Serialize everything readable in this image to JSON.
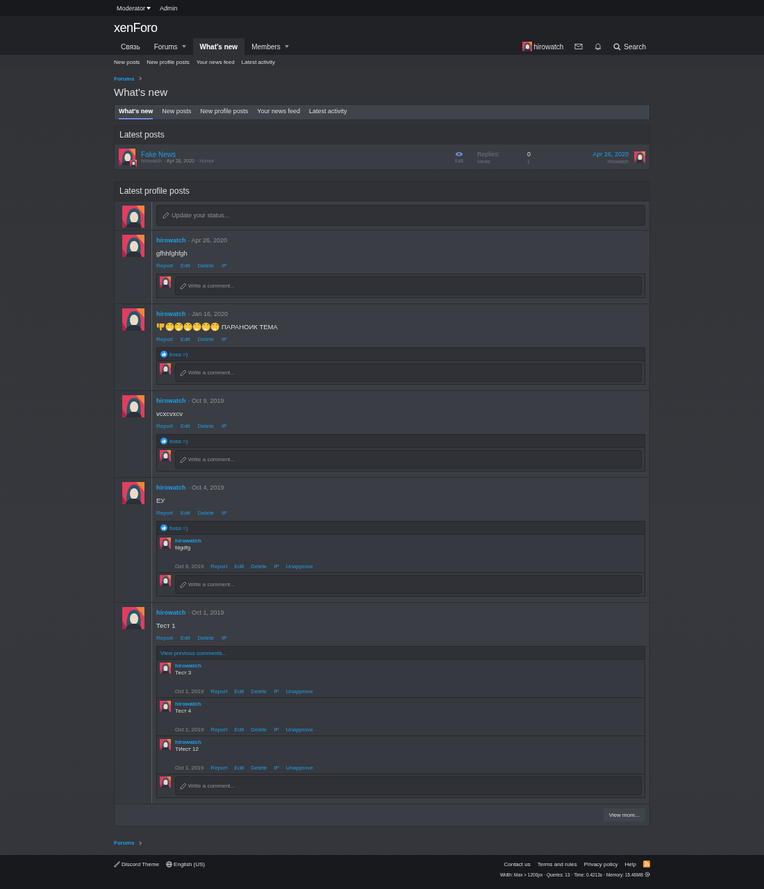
{
  "staff_bar": [
    {
      "label": "Moderator",
      "dropdown": true
    },
    {
      "label": "Admin",
      "dropdown": false
    }
  ],
  "logo": "xenForo",
  "nav": [
    {
      "label": "Связь",
      "dropdown": false,
      "selected": false
    },
    {
      "label": "Forums",
      "dropdown": true,
      "selected": false
    },
    {
      "label": "What's new",
      "dropdown": false,
      "selected": true
    },
    {
      "label": "Members",
      "dropdown": true,
      "selected": false
    }
  ],
  "user": {
    "name": "hirowatch",
    "search": "Search"
  },
  "sub_nav": [
    "New posts",
    "New profile posts",
    "Your news feed",
    "Latest activity"
  ],
  "breadcrumb": "Forums",
  "title": "What's new",
  "tabs": [
    {
      "label": "What's new",
      "selected": true
    },
    {
      "label": "New posts",
      "selected": false
    },
    {
      "label": "New profile posts",
      "selected": false
    },
    {
      "label": "Your news feed",
      "selected": false
    },
    {
      "label": "Latest activity",
      "selected": false
    }
  ],
  "latest_posts": {
    "heading": "Latest posts",
    "threads": [
      {
        "title": "Fake News",
        "author": "hirowatch",
        "date": "· Apr 26, 2020",
        "forum": "· Humor",
        "edit": "Edit",
        "replies_label": "Replies:",
        "replies": "0",
        "views_label": "Views:",
        "views": "1",
        "last_date": "Apr 26, 2020",
        "last_user": "hirowatch"
      }
    ]
  },
  "profile_posts": {
    "heading": "Latest profile posts",
    "status_placeholder": "Update your status...",
    "view_more": "View more...",
    "posts": [
      {
        "author": "hirowatch",
        "date": "· Apr 26, 2020",
        "body": "gfhhfghfgh",
        "actions": [
          "Report",
          "Edit",
          "Delete",
          "IP"
        ],
        "comment_placeholder": "Write a comment..."
      },
      {
        "author": "hirowatch",
        "date": "· Jan 16, 2020",
        "body": "ПАРАНОИК ТЕМА",
        "emojis": [
          {
            "kind": "thumbs-down"
          },
          {
            "kind": "thinking"
          },
          {
            "kind": "thinking"
          },
          {
            "kind": "thinking"
          },
          {
            "kind": "thinking"
          },
          {
            "kind": "thinking"
          },
          {
            "kind": "thinking"
          }
        ],
        "actions": [
          "Report",
          "Edit",
          "Delete",
          "IP"
        ],
        "reaction": "boss =)",
        "comment_placeholder": "Write a comment..."
      },
      {
        "author": "hirowatch",
        "date": "· Oct 9, 2019",
        "body": "vcxcvxcv",
        "actions": [
          "Report",
          "Edit",
          "Delete",
          "IP"
        ],
        "reaction": "boss =)",
        "comment_placeholder": "Write a comment..."
      },
      {
        "author": "hirowatch",
        "date": "· Oct 4, 2019",
        "body": "ЕУ",
        "actions": [
          "Report",
          "Edit",
          "Delete",
          "IP"
        ],
        "reaction": "boss =)",
        "comments": [
          {
            "author": "hirowatch",
            "body": "fdgdfg",
            "date": "Oct 9, 2019",
            "actions": [
              "Report",
              "Edit",
              "Delete",
              "IP",
              "Unapprove"
            ]
          }
        ],
        "comment_placeholder": "Write a comment..."
      },
      {
        "author": "hirowatch",
        "date": "· Oct 1, 2019",
        "body": "Тест 1",
        "actions": [
          "Report",
          "Edit",
          "Delete",
          "IP"
        ],
        "previous": "View previous comments...",
        "comments": [
          {
            "author": "hirowatch",
            "body": "Тест 3",
            "date": "Oct 1, 2019",
            "actions": [
              "Report",
              "Edit",
              "Delete",
              "IP",
              "Unapprove"
            ]
          },
          {
            "author": "hirowatch",
            "body": "Тест 4",
            "date": "Oct 1, 2019",
            "actions": [
              "Report",
              "Edit",
              "Delete",
              "IP",
              "Unapprove"
            ]
          },
          {
            "author": "hirowatch",
            "body": "ТИест 12",
            "date": "Oct 1, 2019",
            "actions": [
              "Report",
              "Edit",
              "Delete",
              "IP",
              "Unapprove"
            ]
          }
        ],
        "comment_placeholder": "Write a comment..."
      }
    ]
  },
  "footer_breadcrumb": "Forums",
  "footer": {
    "style": "Discord Theme",
    "language": "English (US)",
    "links": [
      "Contact us",
      "Terms and rules",
      "Privacy policy",
      "Help"
    ],
    "stats": "Width: Max > 1200px · Queries: 13 · Time: 0.4213s · Memory: 15.46MB"
  }
}
